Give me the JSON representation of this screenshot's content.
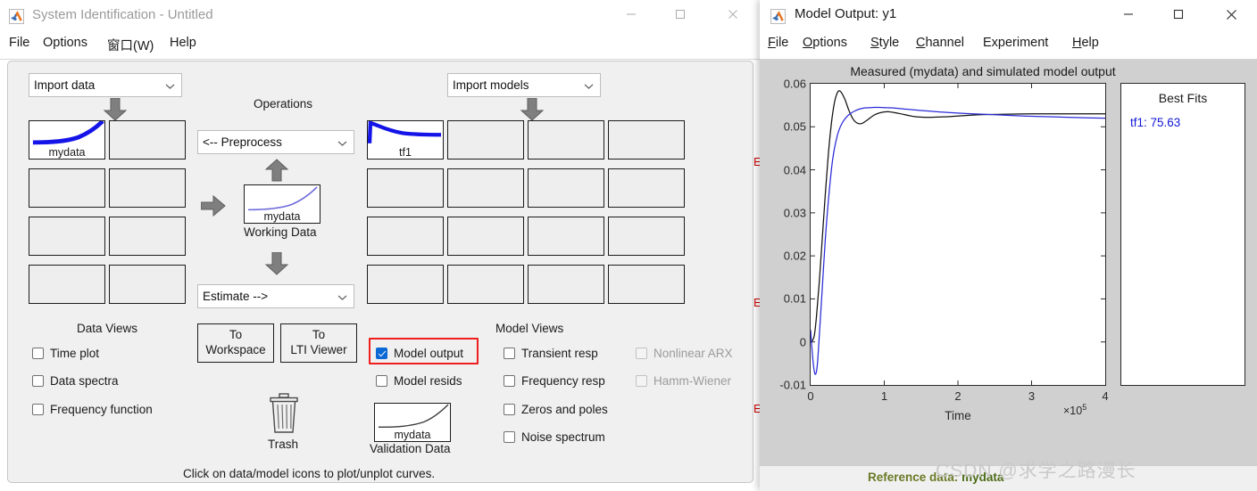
{
  "sysid_window": {
    "title": "System Identification - Untitled",
    "logo_icon": "matlab-logo-icon",
    "window_controls": {
      "minimize": "minimize-icon",
      "maximize": "maximize-icon",
      "close": "close-icon"
    },
    "menu": [
      {
        "label": "File"
      },
      {
        "label": "Options"
      },
      {
        "label": "窗口(W)"
      },
      {
        "label": "Help"
      }
    ],
    "import_data": {
      "value": "Import data"
    },
    "import_models": {
      "value": "Import models"
    },
    "operations_label": "Operations",
    "preprocess": {
      "value": "<-- Preprocess"
    },
    "estimate": {
      "value": "Estimate -->"
    },
    "working_data": {
      "name": "mydata",
      "caption": "Working Data"
    },
    "validation_data": {
      "name": "mydata",
      "caption": "Validation Data"
    },
    "trash": {
      "caption": "Trash",
      "icon": "trash-icon"
    },
    "data_icon": {
      "name": "mydata"
    },
    "model_icon": {
      "name": "tf1"
    },
    "data_views": {
      "title": "Data Views",
      "items": [
        {
          "label": "Time plot",
          "checked": false,
          "enabled": true
        },
        {
          "label": "Data spectra",
          "checked": false,
          "enabled": true
        },
        {
          "label": "Frequency function",
          "checked": false,
          "enabled": true
        }
      ]
    },
    "model_views": {
      "title": "Model Views",
      "column1": [
        {
          "label": "Model output",
          "checked": true,
          "enabled": true,
          "highlighted": true
        },
        {
          "label": "Model resids",
          "checked": false,
          "enabled": true
        }
      ],
      "column2": [
        {
          "label": "Transient resp",
          "checked": false,
          "enabled": true
        },
        {
          "label": "Frequency resp",
          "checked": false,
          "enabled": true
        },
        {
          "label": "Zeros and poles",
          "checked": false,
          "enabled": true
        },
        {
          "label": "Noise spectrum",
          "checked": false,
          "enabled": true
        }
      ],
      "column3": [
        {
          "label": "Nonlinear ARX",
          "checked": false,
          "enabled": false
        },
        {
          "label": "Hamm-Wiener",
          "checked": false,
          "enabled": false
        }
      ]
    },
    "buttons": {
      "to_workspace_line1": "To",
      "to_workspace_line2": "Workspace",
      "to_lti_line1": "To",
      "to_lti_line2": "LTI Viewer"
    },
    "status": "Click on data/model icons to plot/unplot curves.",
    "highlight_color": "#f01d1d"
  },
  "model_output_window": {
    "title": "Model Output: y1",
    "logo_icon": "matlab-logo-icon",
    "window_controls": {
      "minimize": "minimize-icon",
      "maximize": "maximize-icon",
      "close": "close-icon"
    },
    "menu": [
      {
        "mnemonic": "F",
        "rest": "ile"
      },
      {
        "mnemonic": "O",
        "rest": "ptions"
      },
      {
        "mnemonic": "S",
        "rest": "tyle"
      },
      {
        "mnemonic": "C",
        "rest": "hannel"
      },
      {
        "mnemonic": "",
        "rest": "Experiment"
      },
      {
        "mnemonic": "H",
        "rest": "elp"
      }
    ],
    "best_fits": {
      "title": "Best Fits",
      "entries": [
        {
          "label": "tf1: 75.63",
          "color": "#1016d8"
        }
      ]
    },
    "status_prefix": "Reference data:",
    "status_value": "mydata"
  },
  "watermark": "CSDN @求学之路漫长",
  "chart_data": {
    "type": "line",
    "title": "Measured (mydata) and simulated model output",
    "xlabel": "Time",
    "ylabel": "",
    "x_multiplier": "×10",
    "x_multiplier_exp": "5",
    "xlim": [
      0,
      4
    ],
    "ylim": [
      -0.01,
      0.06
    ],
    "xticks": [
      0,
      1,
      2,
      3,
      4
    ],
    "xtick_labels": [
      "0",
      "1",
      "2",
      "3",
      "4"
    ],
    "yticks": [
      -0.01,
      0,
      0.01,
      0.02,
      0.03,
      0.04,
      0.05,
      0.06
    ],
    "ytick_labels": [
      "-0.01",
      "0",
      "0.01",
      "0.02",
      "0.03",
      "0.04",
      "0.05",
      "0.06"
    ],
    "grid": false,
    "legend_position": "external-right",
    "series": [
      {
        "name": "measured (mydata)",
        "color": "#111111",
        "x": [
          0,
          0.02,
          0.05,
          0.08,
          0.12,
          0.16,
          0.2,
          0.24,
          0.28,
          0.32,
          0.36,
          0.4,
          0.46,
          0.52,
          0.58,
          0.64,
          0.7,
          0.78,
          0.86,
          0.95,
          1.05,
          1.2,
          1.4,
          1.6,
          1.8,
          2.0,
          2.3,
          2.6,
          3.0,
          3.4,
          3.8,
          4.0
        ],
        "y": [
          0.0,
          0.0002,
          0.0015,
          0.006,
          0.0145,
          0.0245,
          0.0345,
          0.0435,
          0.0505,
          0.0553,
          0.0578,
          0.0583,
          0.0566,
          0.0538,
          0.0517,
          0.0508,
          0.0508,
          0.0517,
          0.0527,
          0.0533,
          0.0535,
          0.0531,
          0.0524,
          0.0522,
          0.0523,
          0.0525,
          0.0528,
          0.0529,
          0.053,
          0.053,
          0.053,
          0.053
        ]
      },
      {
        "name": "tf1 (simulated)",
        "color": "#2b2bd8",
        "x": [
          0,
          0.03,
          0.06,
          0.09,
          0.12,
          0.16,
          0.2,
          0.25,
          0.3,
          0.36,
          0.42,
          0.5,
          0.58,
          0.66,
          0.75,
          0.85,
          0.95,
          1.1,
          1.3,
          1.5,
          1.8,
          2.1,
          2.5,
          2.9,
          3.3,
          3.7,
          4.0
        ],
        "y": [
          0.0028,
          -0.004,
          -0.0075,
          -0.0055,
          0.002,
          0.013,
          0.024,
          0.0345,
          0.0425,
          0.0478,
          0.0506,
          0.0525,
          0.0535,
          0.0541,
          0.0544,
          0.0545,
          0.0545,
          0.0544,
          0.0541,
          0.0538,
          0.0534,
          0.0531,
          0.0528,
          0.0525,
          0.0523,
          0.0521,
          0.052
        ]
      }
    ]
  }
}
